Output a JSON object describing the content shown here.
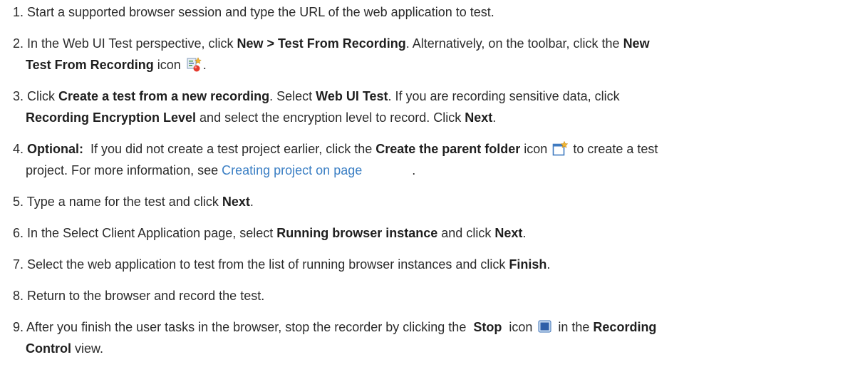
{
  "steps": [
    {
      "num": "1.",
      "text": "Start a supported browser session and type the URL of the web application to test."
    },
    {
      "num": "2.",
      "t1": "In the Web UI Test perspective, click ",
      "b1": "New > Test From Recording",
      "t2": ". Alternatively, on the toolbar, click the ",
      "b2": "New",
      "b3": "Test From Recording",
      "t3": " icon ",
      "icon": "new-test-from-recording-icon",
      "t4": "."
    },
    {
      "num": "3.",
      "t1": "Click ",
      "b1": "Create a test from a new recording",
      "t2": ". Select ",
      "b2": "Web UI Test",
      "t3": ". If you are recording sensitive data, click",
      "b3": "Recording Encryption Level",
      "t4": " and select the encryption level to record. Click ",
      "b4": "Next",
      "t5": "."
    },
    {
      "num": "4.",
      "b1": "Optional:",
      "t1": "  If you did not create a test project earlier, click the ",
      "b2": "Create the parent folder",
      "t2": " icon ",
      "icon": "create-parent-folder-icon",
      "t3": " to create a test",
      "t4": "project. For more information, see ",
      "link": "Creating project on page",
      "t5": "."
    },
    {
      "num": "5.",
      "t1": "Type a name for the test and click ",
      "b1": "Next",
      "t2": "."
    },
    {
      "num": "6.",
      "t1": "In the Select Client Application page, select ",
      "b1": "Running browser instance",
      "t2": " and click ",
      "b2": "Next",
      "t3": "."
    },
    {
      "num": "7.",
      "t1": "Select the web application to test from the list of running browser instances and click ",
      "b1": "Finish",
      "t2": "."
    },
    {
      "num": "8.",
      "text": "Return to the browser and record the test."
    },
    {
      "num": "9.",
      "t1": "After you finish the user tasks in the browser, stop the recorder by clicking the  ",
      "b1": "Stop",
      "t2": "  icon ",
      "icon": "stop-icon",
      "t3": " in the ",
      "b2": "Recording",
      "b3": "Control",
      "t4": " view."
    }
  ]
}
